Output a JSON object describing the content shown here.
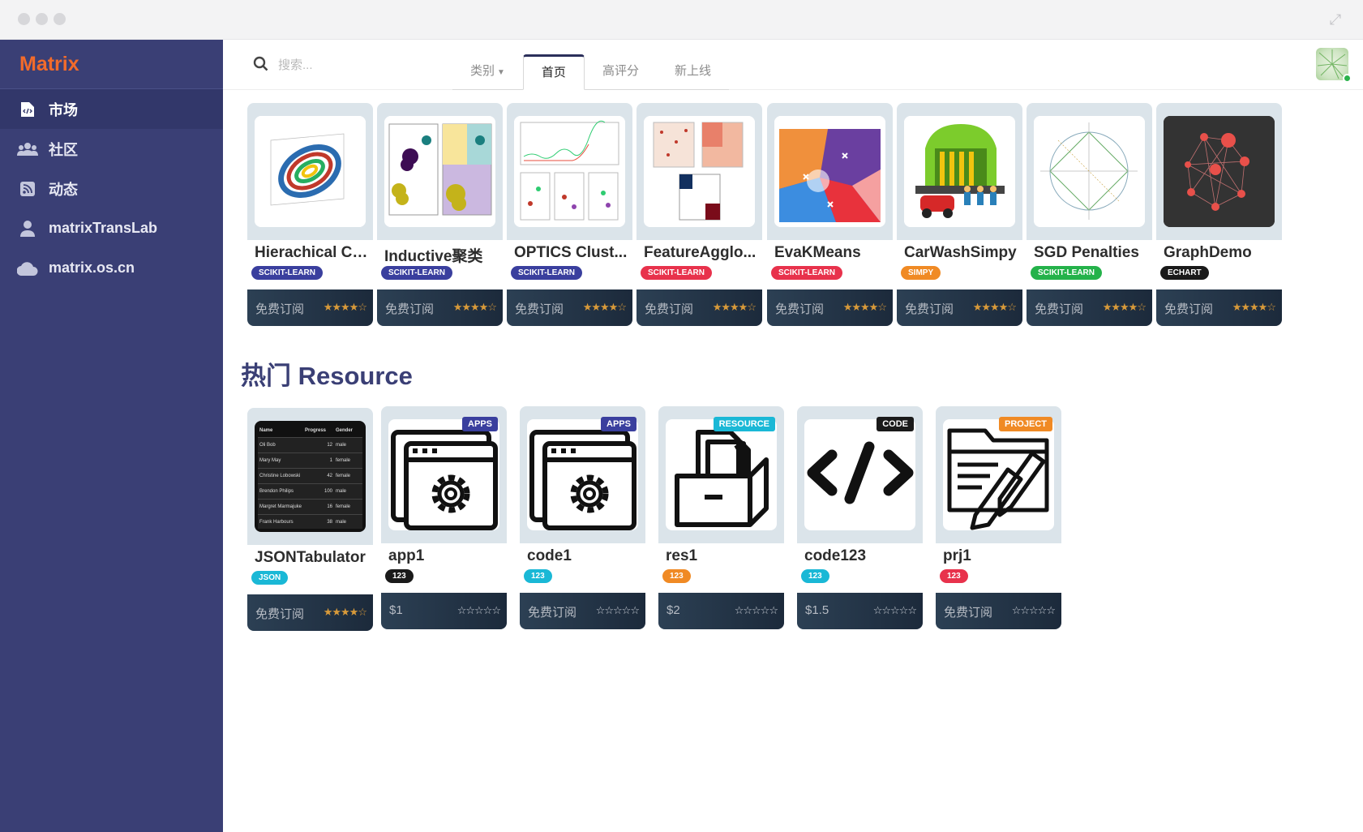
{
  "window": {
    "expand_icon": "expand-icon"
  },
  "sidebar": {
    "brand": "Matrix",
    "items": [
      {
        "label": "市场",
        "icon": "code-file-icon",
        "active": true
      },
      {
        "label": "社区",
        "icon": "users-icon",
        "active": false
      },
      {
        "label": "动态",
        "icon": "rss-icon",
        "active": false
      },
      {
        "label": "matrixTransLab",
        "icon": "user-icon",
        "active": false
      },
      {
        "label": "matrix.os.cn",
        "icon": "cloud-icon",
        "active": false
      }
    ]
  },
  "topbar": {
    "search_placeholder": "搜索...",
    "tabs": [
      {
        "label": "类别",
        "dropdown": true,
        "active": false
      },
      {
        "label": "首页",
        "active": true
      },
      {
        "label": "高评分",
        "active": false
      },
      {
        "label": "新上线",
        "active": false
      }
    ]
  },
  "featured": [
    {
      "title": "Hierachical Cl...",
      "badge": "SCIKIT-LEARN",
      "badge_color": "#3a3f9e",
      "price": "免费订阅",
      "rating": 4
    },
    {
      "title": "Inductive聚类",
      "badge": "SCIKIT-LEARN",
      "badge_color": "#3a3f9e",
      "price": "免费订阅",
      "rating": 4
    },
    {
      "title": "OPTICS Clust...",
      "badge": "SCIKIT-LEARN",
      "badge_color": "#3a3f9e",
      "price": "免费订阅",
      "rating": 4
    },
    {
      "title": "FeatureAgglo...",
      "badge": "SCIKIT-LEARN",
      "badge_color": "#e8324c",
      "price": "免费订阅",
      "rating": 4
    },
    {
      "title": "EvaKMeans",
      "badge": "SCIKIT-LEARN",
      "badge_color": "#e8324c",
      "price": "免费订阅",
      "rating": 4
    },
    {
      "title": "CarWashSimpy",
      "badge": "SIMPY",
      "badge_color": "#f08a24",
      "price": "免费订阅",
      "rating": 4
    },
    {
      "title": "SGD Penalties",
      "badge": "SCIKIT-LEARN",
      "badge_color": "#24b24a",
      "price": "免费订阅",
      "rating": 4
    },
    {
      "title": "GraphDemo",
      "badge": "ECHART",
      "badge_color": "#1a1a1a",
      "price": "免费订阅",
      "rating": 4
    }
  ],
  "section_title": "热门 Resource",
  "resources": [
    {
      "title": "JSONTabulator",
      "badge": "JSON",
      "badge_color": "#1ab8d6",
      "price": "免费订阅",
      "tag": "",
      "tag_color": "",
      "rating": 4,
      "table": {
        "headers": [
          "Name",
          "Progress",
          "Gender"
        ],
        "rows": [
          [
            "Oli Bob",
            "12",
            "male"
          ],
          [
            "Mary May",
            "1",
            "female"
          ],
          [
            "Christine Lobowski",
            "42",
            "female"
          ],
          [
            "Brendon Philips",
            "100",
            "male"
          ],
          [
            "Margret Marmajuke",
            "16",
            "female"
          ],
          [
            "Frank Harbours",
            "38",
            "male"
          ]
        ]
      }
    },
    {
      "title": "app1",
      "badge": "123",
      "badge_color": "#1a1a1a",
      "price": "$1",
      "tag": "APPS",
      "tag_color": "#3a3f9e",
      "rating": 0
    },
    {
      "title": "code1",
      "badge": "123",
      "badge_color": "#1ab8d6",
      "price": "免费订阅",
      "tag": "APPS",
      "tag_color": "#3a3f9e",
      "rating": 0
    },
    {
      "title": "res1",
      "badge": "123",
      "badge_color": "#f08a24",
      "price": "$2",
      "tag": "RESOURCE",
      "tag_color": "#1ab8d6",
      "rating": 0
    },
    {
      "title": "code123",
      "badge": "123",
      "badge_color": "#1ab8d6",
      "price": "$1.5",
      "tag": "CODE",
      "tag_color": "#1a1a1a",
      "rating": 0
    },
    {
      "title": "prj1",
      "badge": "123",
      "badge_color": "#e8324c",
      "price": "免费订阅",
      "tag": "PROJECT",
      "tag_color": "#f08a24",
      "rating": 0
    }
  ]
}
